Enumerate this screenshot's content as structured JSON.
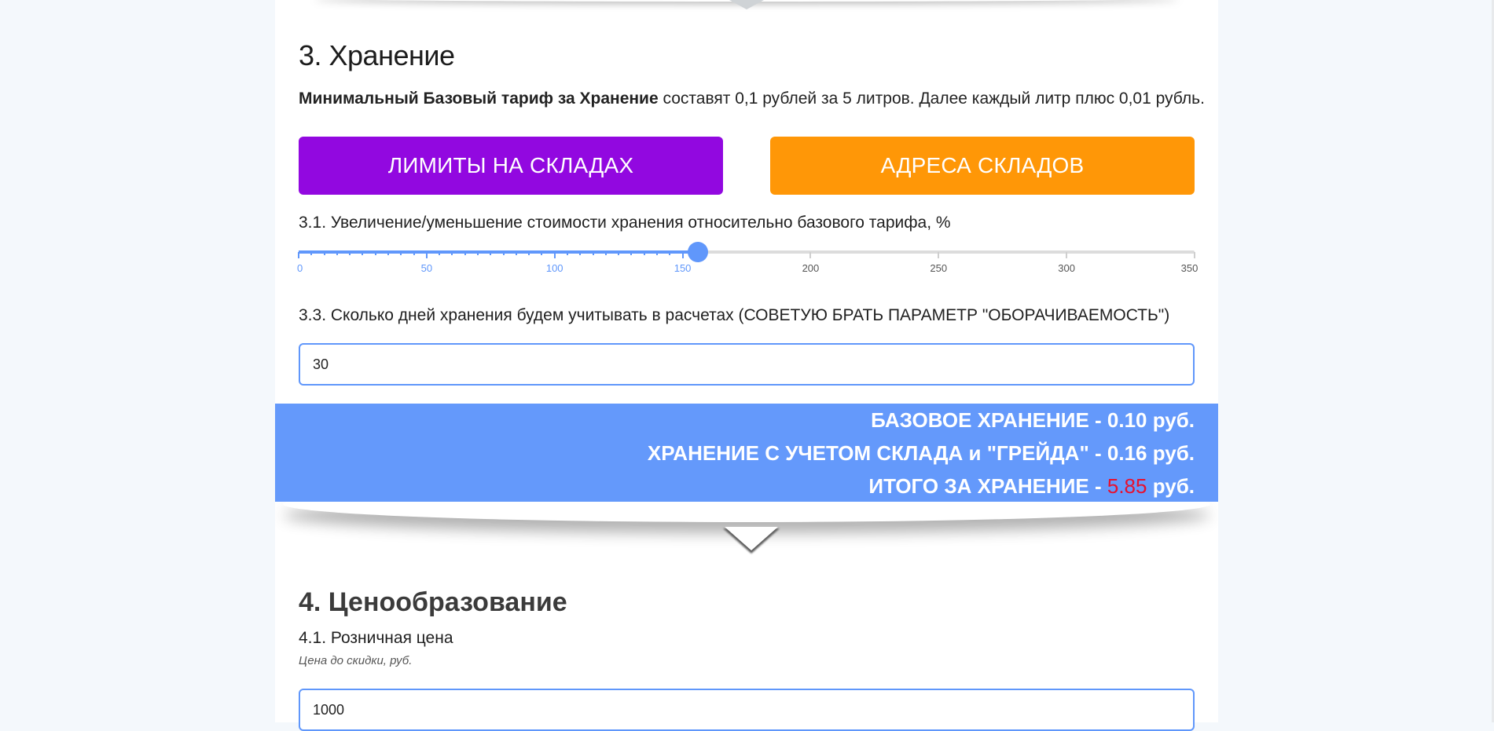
{
  "section3": {
    "title": "3. Хранение",
    "intro_bold": "Минимальный Базовый тариф за Хранение",
    "intro_rest": " составят 0,1 рублей за 5 литров. Далее каждый литр плюс 0,01 рубль.",
    "btn_limits": "ЛИМИТЫ НА СКЛАДАХ",
    "btn_addresses": "АДРЕСА СКЛАДОВ",
    "slider_label": "3.1. Увеличение/уменьшение стоимости хранения относительно базового тарифа, %",
    "slider": {
      "min": 0,
      "max": 350,
      "value": 156,
      "ticks": [
        "0",
        "50",
        "100",
        "150",
        "200",
        "250",
        "300",
        "350"
      ]
    },
    "days_label": "3.3. Сколько дней хранения будем учитывать в расчетах (СОВЕТУЮ БРАТЬ ПАРАМЕТР \"ОБОРАЧИВАЕМОСТЬ\")",
    "days_value": "30",
    "result": {
      "base": "БАЗОВОЕ ХРАНЕНИЕ - 0.10 руб.",
      "grade": "ХРАНЕНИЕ С УЧЕТОМ СКЛАДА и \"ГРЕЙДА\" - 0.16 руб.",
      "total_prefix": "ИТОГО ЗА ХРАНЕНИЕ - ",
      "total_value": "5.85",
      "total_suffix": " руб."
    }
  },
  "section4": {
    "title": "4. Ценообразование",
    "retail_label": "4.1. Розничная цена",
    "retail_hint": "Цена до скидки, руб.",
    "retail_value": "1000"
  },
  "colors": {
    "accent_blue": "#6097fb",
    "purple_button": "#9208e0",
    "orange_button": "#ff9707",
    "result_bg": "#6499fb",
    "total_red": "#e8102e"
  }
}
